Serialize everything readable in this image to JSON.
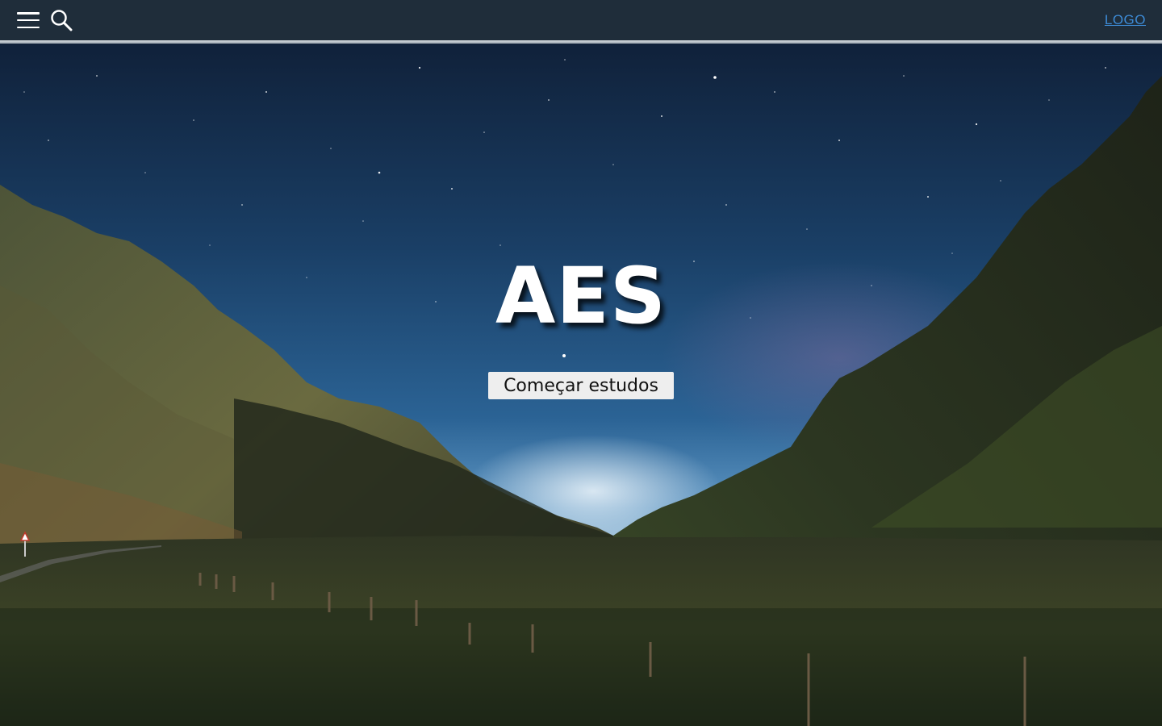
{
  "header": {
    "menu_icon": "hamburger-menu-icon",
    "search_icon": "search-icon",
    "logo_label": "LOGO",
    "background_color": "#1f2d3a",
    "logo_color": "#3d8bd6"
  },
  "hero": {
    "title": "AES",
    "cta_label": "Começar estudos",
    "background": "night-sky-mountain-valley-photo"
  }
}
